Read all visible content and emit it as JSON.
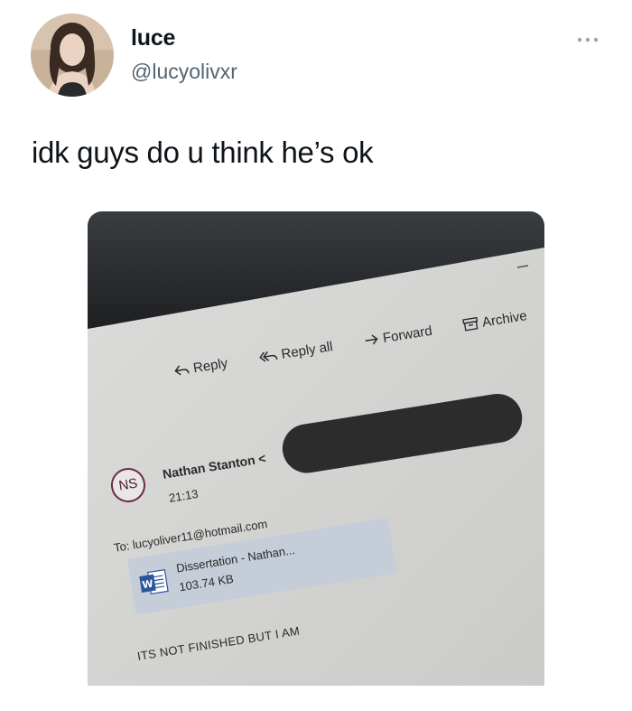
{
  "tweet": {
    "display_name": "luce",
    "handle": "@lucyolivxr",
    "text": "idk guys do u think he’s ok"
  },
  "photo": {
    "email_toolbar": {
      "reply_label": "Reply",
      "reply_all_label": "Reply all",
      "forward_label": "Forward",
      "archive_label": "Archive"
    },
    "email": {
      "sender_initials": "NS",
      "sender_name": "Nathan Stanton",
      "sender_email_open": "<",
      "time": "21:13",
      "to_line": "To: lucyoliver11@hotmail.com",
      "attachment": {
        "filename": "Dissertation - Nathan...",
        "size": "103.74 KB",
        "icon": "word-icon"
      },
      "body": "ITS NOT FINISHED BUT I AM"
    }
  },
  "colors": {
    "handle_gray": "#536471",
    "text_dark": "#0f1419",
    "attachment_blue": "#c5cdd9",
    "ns_avatar_border": "#6a2a4e"
  }
}
